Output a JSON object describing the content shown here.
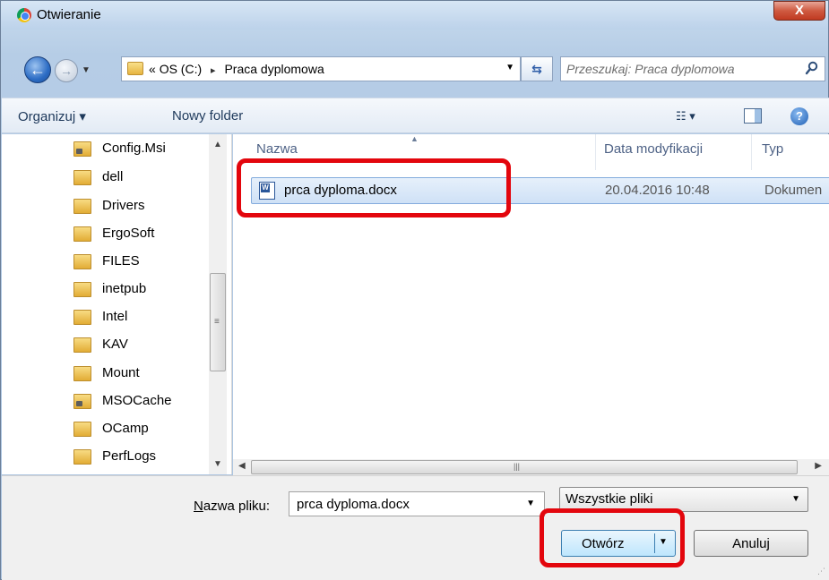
{
  "window": {
    "title": "Otwieranie",
    "close_label": "X"
  },
  "nav": {
    "address": {
      "root": "«",
      "drive": "OS (C:)",
      "separator": "▸",
      "folder": "Praca dyplomowa"
    },
    "search_placeholder": "Przeszukaj: Praca dyplomowa"
  },
  "toolbar": {
    "organize": "Organizuj ▾",
    "new_folder": "Nowy folder",
    "views": "☷ ▾"
  },
  "tree": {
    "items": [
      {
        "label": "Config.Msi",
        "locked": true
      },
      {
        "label": "dell",
        "locked": false
      },
      {
        "label": "Drivers",
        "locked": false
      },
      {
        "label": "ErgoSoft",
        "locked": false
      },
      {
        "label": "FILES",
        "locked": false
      },
      {
        "label": "inetpub",
        "locked": false
      },
      {
        "label": "Intel",
        "locked": false
      },
      {
        "label": "KAV",
        "locked": false
      },
      {
        "label": "Mount",
        "locked": false
      },
      {
        "label": "MSOCache",
        "locked": true
      },
      {
        "label": "OCamp",
        "locked": false
      },
      {
        "label": "PerfLogs",
        "locked": false
      }
    ]
  },
  "files": {
    "columns": {
      "name": "Nazwa",
      "date": "Data modyfikacji",
      "type": "Typ"
    },
    "rows": [
      {
        "name": "prca dyploma.docx",
        "date": "20.04.2016 10:48",
        "type": "Dokumen"
      }
    ]
  },
  "bottom": {
    "filename_label_accel": "N",
    "filename_label_rest": "azwa pliku:",
    "filename_value": "prca dyploma.docx",
    "filter_value": "Wszystkie pliki",
    "open_label": "Otwórz",
    "cancel_label": "Anuluj"
  },
  "colors": {
    "highlight": "#e3060d",
    "selection": "#cfe1f6"
  }
}
